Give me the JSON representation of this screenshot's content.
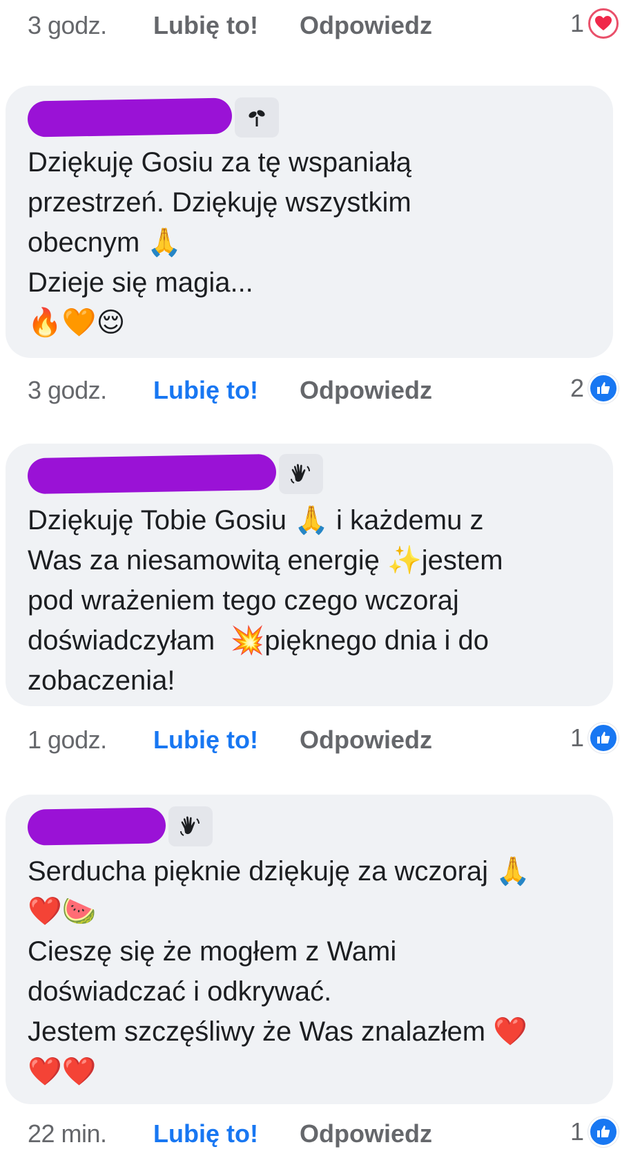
{
  "comments": [
    {
      "time": "3 godz.",
      "like_label": "Lubię to!",
      "reply_label": "Odpowiedz",
      "reaction_count": "1",
      "reaction_icon": "heart-icon",
      "like_active": false
    },
    {
      "author_badge_icon": "sprout-icon",
      "text": "Dziękuję Gosiu za tę wspaniałą\nprzestrzeń. Dziękuję wszystkim\nobecnym 🙏\nDzieje się magia...\n🔥🧡😌",
      "time": "3 godz.",
      "like_label": "Lubię to!",
      "reply_label": "Odpowiedz",
      "reaction_count": "2",
      "reaction_icon": "thumbs-up-icon",
      "like_active": true
    },
    {
      "author_badge_icon": "waving-hand-icon",
      "text": "Dziękuję Tobie Gosiu 🙏 i każdemu z\nWas za niesamowitą energię ✨jestem\npod wrażeniem tego czego wczoraj\ndoświadczyłam  💥pięknego dnia i do\nzobaczenia!",
      "time": "1 godz.",
      "like_label": "Lubię to!",
      "reply_label": "Odpowiedz",
      "reaction_count": "1",
      "reaction_icon": "thumbs-up-icon",
      "like_active": false
    },
    {
      "author_badge_icon": "waving-hand-icon",
      "text": "Serducha pięknie dziękuję za wczoraj 🙏\n❤️🍉\nCieszę się że mogłem z Wami\ndoświadczać i odkrywać.\nJestem szczęśliwy że Was znalazłem ❤️\n❤️❤️",
      "time": "22 min.",
      "like_label": "Lubię to!",
      "reply_label": "Odpowiedz",
      "reaction_count": "1",
      "reaction_icon": "thumbs-up-icon",
      "like_active": false
    }
  ],
  "colors": {
    "bubble_bg": "#f0f2f5",
    "meta_text": "#65676b",
    "like_active": "#1877f2",
    "redaction": "#9a12d6",
    "heart": "#e9506a"
  }
}
